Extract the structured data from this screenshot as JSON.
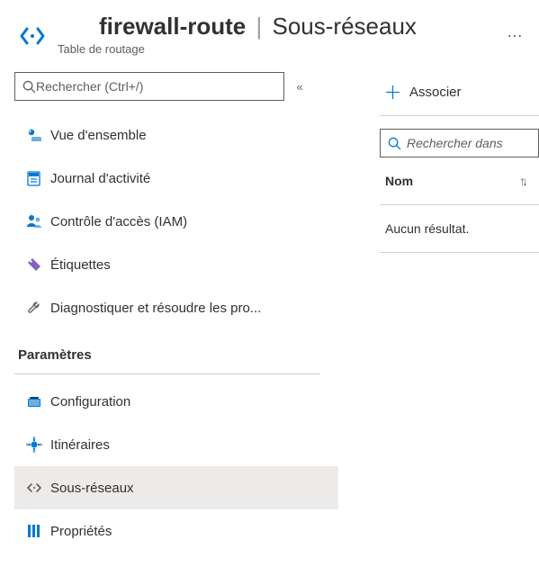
{
  "header": {
    "title_main": "firewall-route",
    "title_sub": "Sous-réseaux",
    "subtitle": "Table de routage",
    "more": "…"
  },
  "sidebar": {
    "search_placeholder": "Rechercher (Ctrl+/)",
    "collapse_glyph": "«",
    "items": [
      {
        "id": "overview",
        "label": "Vue d'ensemble"
      },
      {
        "id": "activity-log",
        "label": "Journal d'activité"
      },
      {
        "id": "access-control",
        "label": "Contrôle d'accès (IAM)"
      },
      {
        "id": "tags",
        "label": "Étiquettes"
      },
      {
        "id": "diagnose",
        "label": "Diagnostiquer et résoudre les pro..."
      }
    ],
    "section_heading": "Paramètres",
    "settings_items": [
      {
        "id": "configuration",
        "label": "Configuration"
      },
      {
        "id": "routes",
        "label": "Itinéraires"
      },
      {
        "id": "subnets",
        "label": "Sous-réseaux",
        "selected": true
      },
      {
        "id": "properties",
        "label": "Propriétés"
      }
    ]
  },
  "main": {
    "associate_label": "Associer",
    "filter_placeholder": "Rechercher dans",
    "column_name": "Nom",
    "empty_text": "Aucun résultat."
  }
}
